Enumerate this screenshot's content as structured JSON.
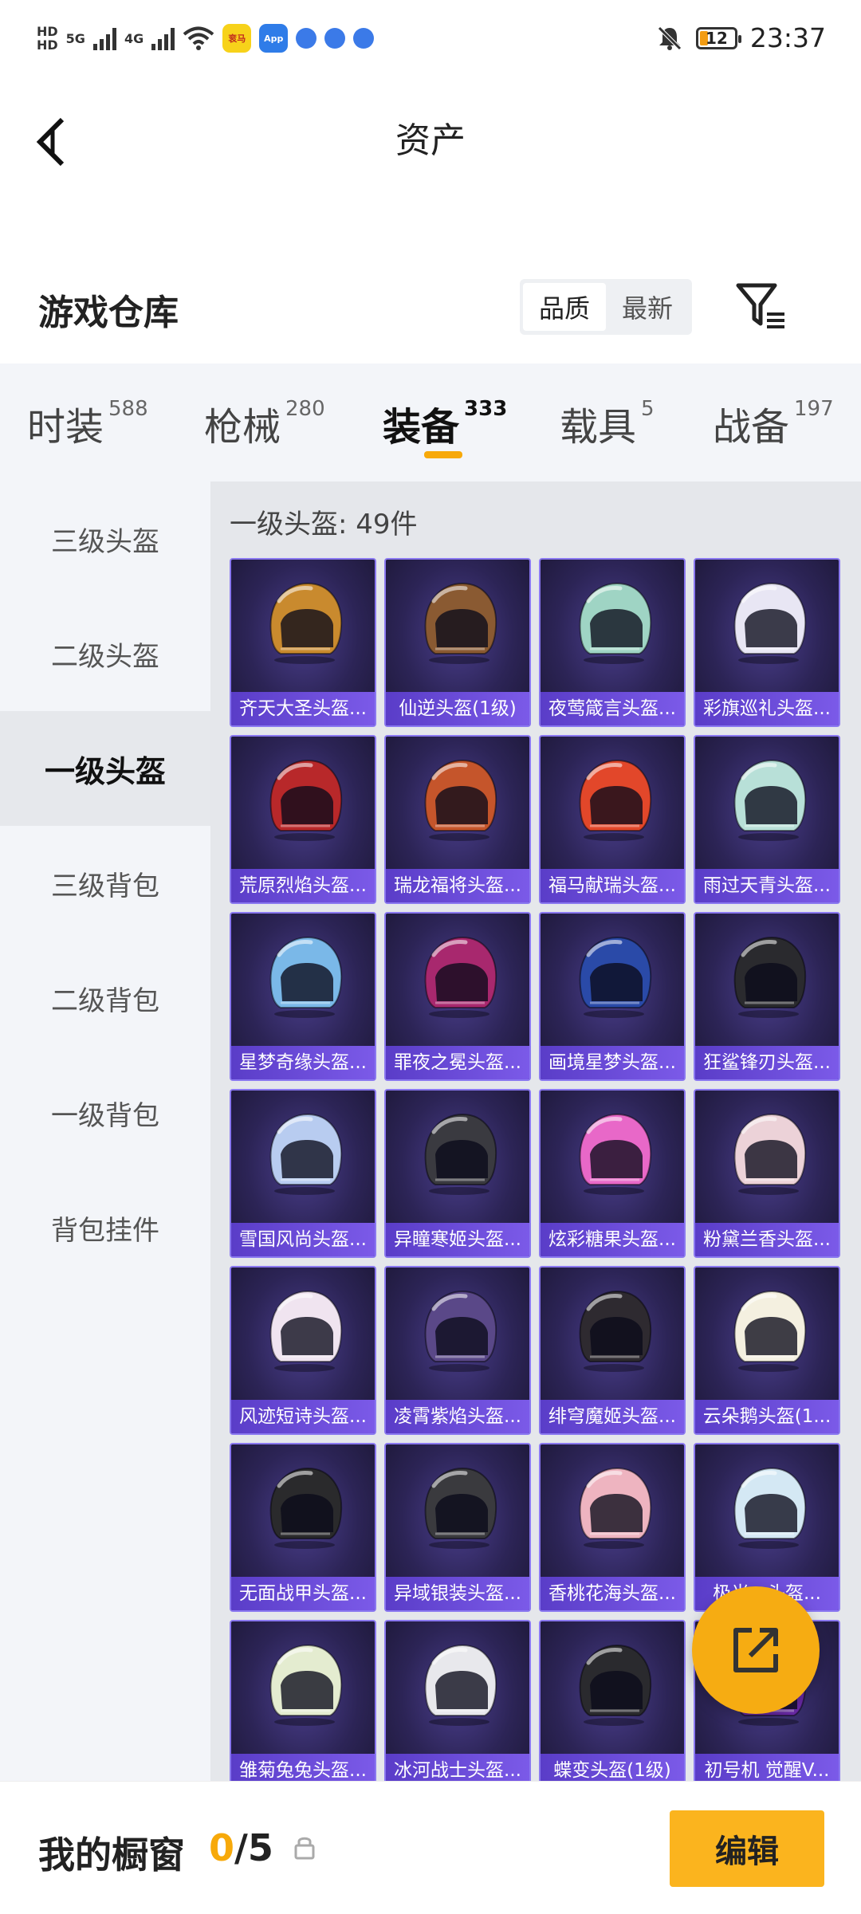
{
  "status_bar": {
    "network_a": "5G",
    "network_b": "4G",
    "hd_a": "HD",
    "hd_b": "HD",
    "battery": "12",
    "time": "23:37",
    "app_icon_1": "衮马",
    "app_icon_2": "App"
  },
  "header": {
    "title": "资产",
    "section_title": "游戏仓库",
    "sort_options": [
      "品质",
      "最新"
    ],
    "active_sort": "品质"
  },
  "tabs": [
    {
      "label": "时装",
      "count": "588"
    },
    {
      "label": "枪械",
      "count": "280"
    },
    {
      "label": "装备",
      "count": "333"
    },
    {
      "label": "载具",
      "count": "5"
    },
    {
      "label": "战备",
      "count": "197"
    }
  ],
  "active_tab": "装备",
  "side_nav": [
    "三级头盔",
    "二级头盔",
    "一级头盔",
    "三级背包",
    "二级背包",
    "一级背包",
    "背包挂件"
  ],
  "active_side": "一级头盔",
  "content": {
    "count_label": "一级头盔: 49件",
    "items": [
      {
        "name": "齐天大圣头盔...",
        "color": "#c98a2e"
      },
      {
        "name": "仙逆头盔(1级)",
        "color": "#8a5a32"
      },
      {
        "name": "夜莺箴言头盔...",
        "color": "#9fd4c4"
      },
      {
        "name": "彩旗巡礼头盔...",
        "color": "#e8e6f4"
      },
      {
        "name": "荒原烈焰头盔...",
        "color": "#b8282a"
      },
      {
        "name": "瑞龙福将头盔...",
        "color": "#c5552b"
      },
      {
        "name": "福马献瑞头盔...",
        "color": "#e2472a"
      },
      {
        "name": "雨过天青头盔...",
        "color": "#b8e0d8"
      },
      {
        "name": "星梦奇缘头盔...",
        "color": "#7ab8e8"
      },
      {
        "name": "罪夜之冕头盔...",
        "color": "#a8286e"
      },
      {
        "name": "画境星梦头盔...",
        "color": "#2a4aa8"
      },
      {
        "name": "狂鲨锋刃头盔...",
        "color": "#2a2a2e"
      },
      {
        "name": "雪国风尚头盔...",
        "color": "#b8ccf0"
      },
      {
        "name": "异瞳寒姬头盔...",
        "color": "#3a3a40"
      },
      {
        "name": "炫彩糖果头盔...",
        "color": "#e868c8"
      },
      {
        "name": "粉黛兰香头盔...",
        "color": "#ecd2d8"
      },
      {
        "name": "风迹短诗头盔...",
        "color": "#f0e4f0"
      },
      {
        "name": "凌霄紫焰头盔...",
        "color": "#5a4888"
      },
      {
        "name": "绯穹魔姬头盔...",
        "color": "#2e2a30"
      },
      {
        "name": "云朵鹅头盔(1...",
        "color": "#f4f0e0"
      },
      {
        "name": "无面战甲头盔...",
        "color": "#2a2a2c"
      },
      {
        "name": "异域银装头盔...",
        "color": "#3a3a3e"
      },
      {
        "name": "香桃花海头盔...",
        "color": "#eeb4c0"
      },
      {
        "name": "极光...头盔...",
        "color": "#d4e8f4"
      },
      {
        "name": "雏菊兔兔头盔...",
        "color": "#e4ecd0"
      },
      {
        "name": "冰河战士头盔...",
        "color": "#e8e8ec"
      },
      {
        "name": "蝶变头盔(1级)",
        "color": "#2a2a2e"
      },
      {
        "name": "初号机 觉醒V...",
        "color": "#6a2aa8"
      }
    ]
  },
  "bottom_bar": {
    "label": "我的橱窗",
    "current": "0",
    "separator": "/",
    "max": "5",
    "edit_label": "编辑"
  },
  "colors": {
    "accent": "#f7a90a",
    "card_bg": "#2c2456",
    "card_label": "#6a4ad8"
  },
  "icons": [
    "back-arrow-icon",
    "filter-icon",
    "share-icon",
    "lock-icon",
    "mute-icon",
    "wifi-icon",
    "battery-icon"
  ]
}
